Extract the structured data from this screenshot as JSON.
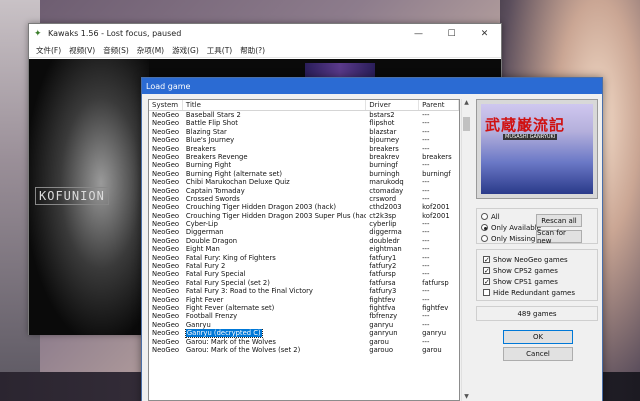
{
  "main_window": {
    "title": "Kawaks 1.56 - Lost focus, paused",
    "menu": [
      "文件(F)",
      "视频(V)",
      "音频(S)",
      "杂项(M)",
      "游戏(G)",
      "工具(T)",
      "帮助(?)"
    ]
  },
  "screen": {
    "logo_text": "KOFUNION"
  },
  "dialog": {
    "title": "Load game",
    "columns": {
      "system": "System",
      "title": "Title",
      "driver": "Driver",
      "parent": "Parent"
    },
    "rows": [
      {
        "system": "NeoGeo",
        "title": "Baseball Stars 2",
        "driver": "bstars2",
        "parent": "---"
      },
      {
        "system": "NeoGeo",
        "title": "Battle Flip Shot",
        "driver": "flipshot",
        "parent": "---"
      },
      {
        "system": "NeoGeo",
        "title": "Blazing Star",
        "driver": "blazstar",
        "parent": "---"
      },
      {
        "system": "NeoGeo",
        "title": "Blue's Journey",
        "driver": "bjourney",
        "parent": "---"
      },
      {
        "system": "NeoGeo",
        "title": "Breakers",
        "driver": "breakers",
        "parent": "---"
      },
      {
        "system": "NeoGeo",
        "title": "Breakers Revenge",
        "driver": "breakrev",
        "parent": "breakers"
      },
      {
        "system": "NeoGeo",
        "title": "Burning Fight",
        "driver": "burningf",
        "parent": "---"
      },
      {
        "system": "NeoGeo",
        "title": "Burning Fight (alternate set)",
        "driver": "burningh",
        "parent": "burningf"
      },
      {
        "system": "NeoGeo",
        "title": "Chibi Marukochan Deluxe Quiz",
        "driver": "marukodq",
        "parent": "---"
      },
      {
        "system": "NeoGeo",
        "title": "Captain Tomaday",
        "driver": "ctomaday",
        "parent": "---"
      },
      {
        "system": "NeoGeo",
        "title": "Crossed Swords",
        "driver": "crsword",
        "parent": "---"
      },
      {
        "system": "NeoGeo",
        "title": "Crouching Tiger Hidden Dragon 2003 (hack)",
        "driver": "cthd2003",
        "parent": "kof2001"
      },
      {
        "system": "NeoGeo",
        "title": "Crouching Tiger Hidden Dragon 2003 Super Plus (hack)",
        "driver": "ct2k3sp",
        "parent": "kof2001"
      },
      {
        "system": "NeoGeo",
        "title": "Cyber-Lip",
        "driver": "cyberlip",
        "parent": "---"
      },
      {
        "system": "NeoGeo",
        "title": "Diggerman",
        "driver": "diggerma",
        "parent": "---"
      },
      {
        "system": "NeoGeo",
        "title": "Double Dragon",
        "driver": "doubledr",
        "parent": "---"
      },
      {
        "system": "NeoGeo",
        "title": "Eight Man",
        "driver": "eightman",
        "parent": "---"
      },
      {
        "system": "NeoGeo",
        "title": "Fatal Fury: King of Fighters",
        "driver": "fatfury1",
        "parent": "---"
      },
      {
        "system": "NeoGeo",
        "title": "Fatal Fury 2",
        "driver": "fatfury2",
        "parent": "---"
      },
      {
        "system": "NeoGeo",
        "title": "Fatal Fury Special",
        "driver": "fatfursp",
        "parent": "---"
      },
      {
        "system": "NeoGeo",
        "title": "Fatal Fury Special (set 2)",
        "driver": "fatfursa",
        "parent": "fatfursp"
      },
      {
        "system": "NeoGeo",
        "title": "Fatal Fury 3: Road to the Final Victory",
        "driver": "fatfury3",
        "parent": "---"
      },
      {
        "system": "NeoGeo",
        "title": "Fight Fever",
        "driver": "fightfev",
        "parent": "---"
      },
      {
        "system": "NeoGeo",
        "title": "Fight Fever (alternate set)",
        "driver": "fightfva",
        "parent": "fightfev"
      },
      {
        "system": "NeoGeo",
        "title": "Football Frenzy",
        "driver": "fbfrenzy",
        "parent": "---"
      },
      {
        "system": "NeoGeo",
        "title": "Ganryu",
        "driver": "ganryu",
        "parent": "---"
      },
      {
        "system": "NeoGeo",
        "title": "Ganryu (decrypted C)",
        "driver": "ganryun",
        "parent": "ganryu",
        "selected": true
      },
      {
        "system": "NeoGeo",
        "title": "Garou: Mark of the Wolves",
        "driver": "garou",
        "parent": "---"
      },
      {
        "system": "NeoGeo",
        "title": "Garou: Mark of the Wolves (set 2)",
        "driver": "garouo",
        "parent": "garou"
      }
    ],
    "preview": {
      "kanji": "武蔵巌流記",
      "subtitle": "MUSASHI GANRYUKI"
    },
    "filters": {
      "all": "All",
      "only_available": "Only Available",
      "only_missing": "Only Missing",
      "selected": "only_available"
    },
    "buttons": {
      "rescan": "Rescan all",
      "scan_new": "Scan for new",
      "ok": "OK",
      "cancel": "Cancel"
    },
    "options": {
      "show_neogeo": "Show NeoGeo games",
      "show_cps2": "Show CPS2 games",
      "show_cps1": "Show CPS1 games",
      "hide_redundant": "Hide Redundant games"
    },
    "option_states": {
      "show_neogeo": true,
      "show_cps2": true,
      "show_cps1": true,
      "hide_redundant": false
    },
    "game_count": "489 games"
  },
  "colors": {
    "titlebar_active": "#2b6bd3",
    "selection": "#0078d7",
    "ok_border": "#0078d7"
  }
}
